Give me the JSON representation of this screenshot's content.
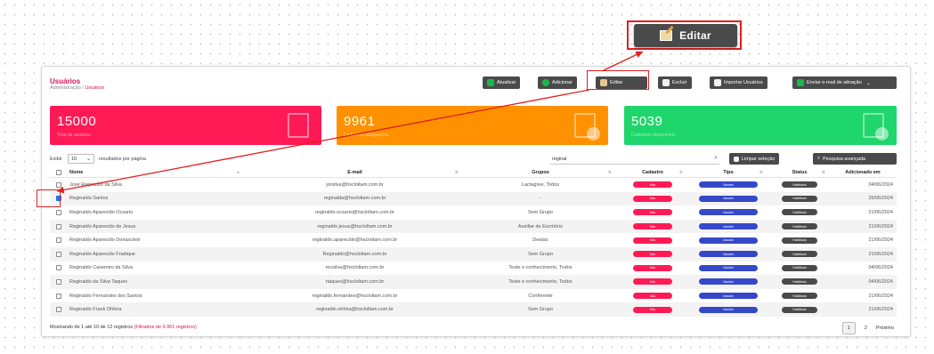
{
  "callout": {
    "edit_label": "Editar"
  },
  "header": {
    "title": "Usuários",
    "breadcrumb_root": "Administração",
    "breadcrumb_sep": " / ",
    "breadcrumb_current": "Usuários"
  },
  "toolbar": {
    "atualizar": "Atualizar",
    "adicionar": "Adicionar",
    "editar": "Editar",
    "excluir": "Excluir",
    "importar": "Importar Usuários",
    "enviar": "Enviar e-mail de ativação"
  },
  "stats": [
    {
      "value": "15000",
      "label": "Total de usuários"
    },
    {
      "value": "9961",
      "label": "Cadastros obrigatórios"
    },
    {
      "value": "5039",
      "label": "Cadastros disponíveis"
    }
  ],
  "list": {
    "show_label": "Exibir",
    "page_size": "10",
    "per_page_label": "resultados por página",
    "search_value": "reginal",
    "clear_button": "Limpar seleção",
    "advanced_button": "Pesquisa avançada"
  },
  "columns": [
    "Nome",
    "E-mail",
    "Grupos",
    "Cadastro",
    "Tipo",
    "Status",
    "Adicionado em"
  ],
  "rows": [
    {
      "checked": false,
      "name": "José Reginaldo da Silva",
      "email": "jorsilva@hscloltam.com.br",
      "group": "Lactagree, Todos",
      "cadastro": "Não",
      "tipo": "Usuário",
      "status": "Habilitado",
      "date": "04/06/2024"
    },
    {
      "checked": true,
      "name": "Reginalda Santos",
      "email": "reginalda@hscloltam.com.br",
      "group": "-",
      "cadastro": "Não",
      "tipo": "Usuário",
      "status": "Habilitado",
      "date": "25/06/2024"
    },
    {
      "checked": false,
      "name": "Reginaldo Aparecido Ocsario",
      "email": "reginaldo.ocsario@hscloltam.com.br",
      "group": "Sem Grupo",
      "cadastro": "Não",
      "tipo": "Usuário",
      "status": "Habilitado",
      "date": "21/06/2024"
    },
    {
      "checked": false,
      "name": "Reginaldo Aparecido de Jesus",
      "email": "reginaldo.jesus@hscloltam.com.br",
      "group": "Auxiliar de Escritório",
      "cadastro": "Não",
      "tipo": "Usuário",
      "status": "Habilitado",
      "date": "21/06/2024"
    },
    {
      "checked": false,
      "name": "Reginaldo Aparecido Donascieni",
      "email": "reginaldo.aparecido@hscloltam.com.br",
      "group": "Dealao",
      "cadastro": "Não",
      "tipo": "Usuário",
      "status": "Habilitado",
      "date": "21/06/2024"
    },
    {
      "checked": false,
      "name": "Reginaldo Aparecido Fradique",
      "email": "Reginaldo@hscloltam.com.br",
      "group": "Sem Grupo",
      "cadastro": "Não",
      "tipo": "Usuário",
      "status": "Habilitado",
      "date": "21/06/2024"
    },
    {
      "checked": false,
      "name": "Reginaldo Casemiro da Silva",
      "email": "recsilva@hscloltam.com.br",
      "group": "Teste e conhecimento, Todos",
      "cadastro": "Não",
      "tipo": "Usuário",
      "status": "Habilitado",
      "date": "04/06/2024"
    },
    {
      "checked": false,
      "name": "Reginaldo da Silva Taques",
      "email": "rtaques@hscloltam.com.br",
      "group": "Teste e conhecimento, Todos",
      "cadastro": "Não",
      "tipo": "Usuário",
      "status": "Habilitado",
      "date": "04/06/2024"
    },
    {
      "checked": false,
      "name": "Reginaldo Fernandes dos Santos",
      "email": "reginaldo.fernandes@hscloltam.com.br",
      "group": "Conferente",
      "cadastro": "Não",
      "tipo": "Usuário",
      "status": "Habilitado",
      "date": "21/06/2024"
    },
    {
      "checked": false,
      "name": "Reginaldo Frank Ohhira",
      "email": "reginaldo.ohhira@hscloltam.com.br",
      "group": "Sem Grupo",
      "cadastro": "Não",
      "tipo": "Usuário",
      "status": "Habilitado",
      "date": "21/06/2024"
    }
  ],
  "footer": {
    "info": "Mostrando de 1 até 10 de 12 registros",
    "filtered": "(Filtrados de 9.961 registros)",
    "page1": "1",
    "page2": "2",
    "next": "Próximo"
  },
  "colors": {
    "accent": "#d4145a",
    "pink": "#ff1a56",
    "orange": "#ff9100",
    "green": "#1ed66b",
    "annotation": "#e02020"
  }
}
